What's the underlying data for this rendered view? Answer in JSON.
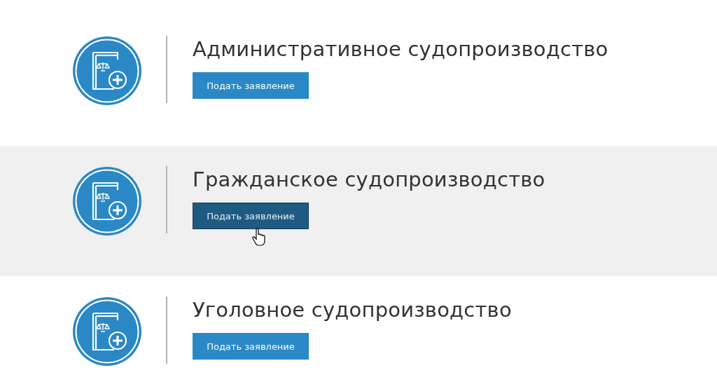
{
  "sections": [
    {
      "title": "Административное судопроизводство",
      "button": "Подать заявление",
      "hovered": false
    },
    {
      "title": "Гражданское судопроизводство",
      "button": "Подать заявление",
      "hovered": true
    },
    {
      "title": "Уголовное судопроизводство",
      "button": "Подать заявление",
      "hovered": false
    }
  ]
}
